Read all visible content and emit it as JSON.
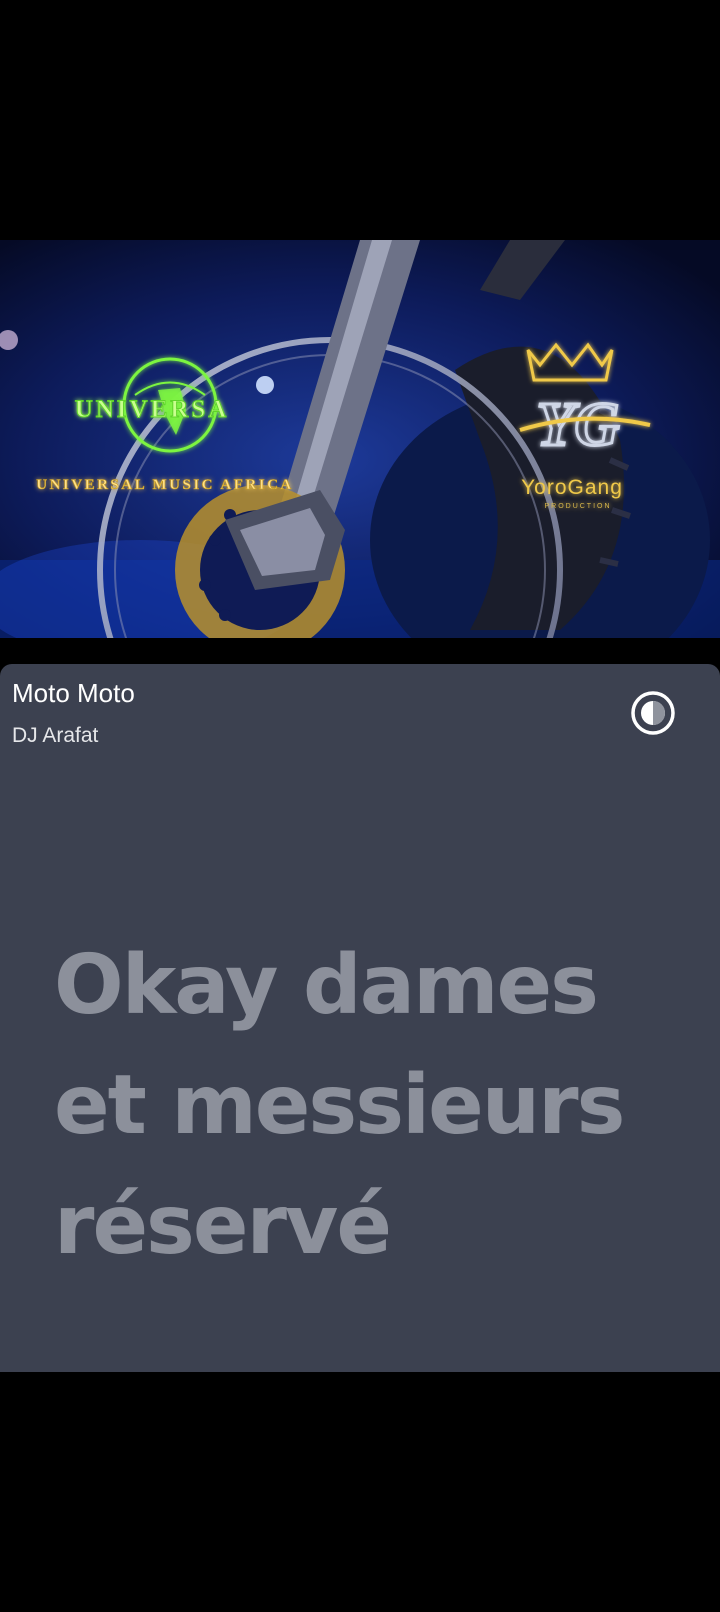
{
  "video": {
    "logos": {
      "universal_wordmark": "UNIVERSA",
      "universal_subtitle": "UNIVERSAL MUSIC AFRICA",
      "yorogang_monogram": "YG",
      "yorogang_name": "YoroGang",
      "yorogang_tag": "PRODUCTION"
    },
    "colors": {
      "universal_green": "#7cf541",
      "gold": "#f0c94a"
    }
  },
  "track": {
    "title": "Moto Moto",
    "artist": "DJ Arafat"
  },
  "share_button": {
    "icon": "share-icon"
  },
  "lyrics": {
    "lines": [
      "Okay dames",
      "et messieurs",
      "réservé"
    ]
  },
  "theme": {
    "sheet_background": "#3c4150",
    "lyric_color": "#8c909b"
  }
}
